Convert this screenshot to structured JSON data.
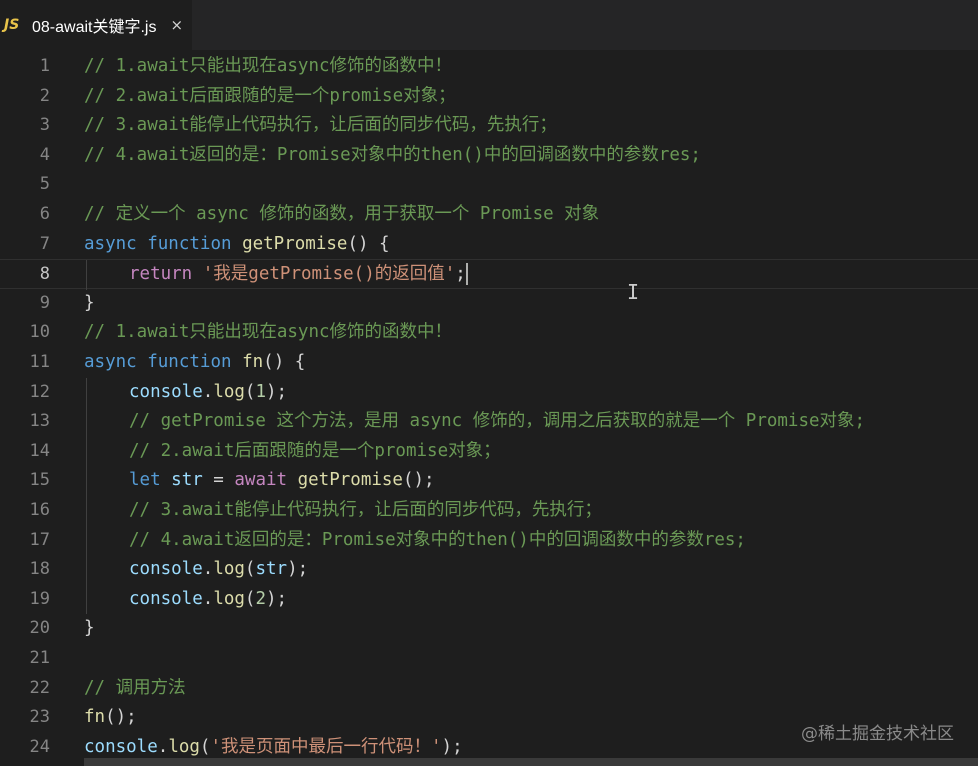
{
  "tab": {
    "icon_text": "JS",
    "filename": "08-await关键字.js",
    "close_glyph": "×"
  },
  "watermark": "@稀土掘金技术社区",
  "active_line": 8,
  "lines": [
    {
      "n": "1",
      "indent": 0,
      "tokens": [
        [
          "cm",
          "// 1.await只能出现在async修饰的函数中！"
        ]
      ]
    },
    {
      "n": "2",
      "indent": 0,
      "tokens": [
        [
          "cm",
          "// 2.await后面跟随的是一个promise对象；"
        ]
      ]
    },
    {
      "n": "3",
      "indent": 0,
      "tokens": [
        [
          "cm",
          "// 3.await能停止代码执行，让后面的同步代码，先执行；"
        ]
      ]
    },
    {
      "n": "4",
      "indent": 0,
      "tokens": [
        [
          "cm",
          "// 4.await返回的是：Promise对象中的then()中的回调函数中的参数res;"
        ]
      ]
    },
    {
      "n": "5",
      "indent": 0,
      "tokens": []
    },
    {
      "n": "6",
      "indent": 0,
      "tokens": [
        [
          "cm",
          "// 定义一个 async 修饰的函数，用于获取一个 Promise 对象"
        ]
      ]
    },
    {
      "n": "7",
      "indent": 0,
      "tokens": [
        [
          "kw",
          "async"
        ],
        [
          "pun",
          " "
        ],
        [
          "kw",
          "function"
        ],
        [
          "pun",
          " "
        ],
        [
          "fn",
          "getPromise"
        ],
        [
          "pun",
          "() {"
        ]
      ]
    },
    {
      "n": "8",
      "indent": 1,
      "tokens": [
        [
          "ctl",
          "return"
        ],
        [
          "pun",
          " "
        ],
        [
          "str",
          "'我是getPromise()的返回值'"
        ],
        [
          "pun",
          ";"
        ]
      ],
      "cursor": true
    },
    {
      "n": "9",
      "indent": 0,
      "tokens": [
        [
          "pun",
          "}"
        ]
      ]
    },
    {
      "n": "10",
      "indent": 0,
      "tokens": [
        [
          "cm",
          "// 1.await只能出现在async修饰的函数中！"
        ]
      ]
    },
    {
      "n": "11",
      "indent": 0,
      "tokens": [
        [
          "kw",
          "async"
        ],
        [
          "pun",
          " "
        ],
        [
          "kw",
          "function"
        ],
        [
          "pun",
          " "
        ],
        [
          "fn",
          "fn"
        ],
        [
          "pun",
          "() {"
        ]
      ]
    },
    {
      "n": "12",
      "indent": 1,
      "tokens": [
        [
          "var",
          "console"
        ],
        [
          "pun",
          "."
        ],
        [
          "fn",
          "log"
        ],
        [
          "pun",
          "("
        ],
        [
          "num",
          "1"
        ],
        [
          "pun",
          ");"
        ]
      ]
    },
    {
      "n": "13",
      "indent": 1,
      "tokens": [
        [
          "cm",
          "// getPromise 这个方法，是用 async 修饰的，调用之后获取的就是一个 Promise对象;"
        ]
      ]
    },
    {
      "n": "14",
      "indent": 1,
      "tokens": [
        [
          "cm",
          "// 2.await后面跟随的是一个promise对象；"
        ]
      ]
    },
    {
      "n": "15",
      "indent": 1,
      "tokens": [
        [
          "kw",
          "let"
        ],
        [
          "pun",
          " "
        ],
        [
          "var",
          "str"
        ],
        [
          "pun",
          " = "
        ],
        [
          "ctl",
          "await"
        ],
        [
          "pun",
          " "
        ],
        [
          "fn",
          "getPromise"
        ],
        [
          "pun",
          "();"
        ]
      ]
    },
    {
      "n": "16",
      "indent": 1,
      "tokens": [
        [
          "cm",
          "// 3.await能停止代码执行，让后面的同步代码，先执行；"
        ]
      ]
    },
    {
      "n": "17",
      "indent": 1,
      "tokens": [
        [
          "cm",
          "// 4.await返回的是：Promise对象中的then()中的回调函数中的参数res;"
        ]
      ]
    },
    {
      "n": "18",
      "indent": 1,
      "tokens": [
        [
          "var",
          "console"
        ],
        [
          "pun",
          "."
        ],
        [
          "fn",
          "log"
        ],
        [
          "pun",
          "("
        ],
        [
          "var",
          "str"
        ],
        [
          "pun",
          ");"
        ]
      ]
    },
    {
      "n": "19",
      "indent": 1,
      "tokens": [
        [
          "var",
          "console"
        ],
        [
          "pun",
          "."
        ],
        [
          "fn",
          "log"
        ],
        [
          "pun",
          "("
        ],
        [
          "num",
          "2"
        ],
        [
          "pun",
          ");"
        ]
      ]
    },
    {
      "n": "20",
      "indent": 0,
      "tokens": [
        [
          "pun",
          "}"
        ]
      ]
    },
    {
      "n": "21",
      "indent": 0,
      "tokens": []
    },
    {
      "n": "22",
      "indent": 0,
      "tokens": [
        [
          "cm",
          "// 调用方法"
        ]
      ]
    },
    {
      "n": "23",
      "indent": 0,
      "tokens": [
        [
          "fn",
          "fn"
        ],
        [
          "pun",
          "();"
        ]
      ]
    },
    {
      "n": "24",
      "indent": 0,
      "tokens": [
        [
          "var",
          "console"
        ],
        [
          "pun",
          "."
        ],
        [
          "fn",
          "log"
        ],
        [
          "pun",
          "("
        ],
        [
          "str",
          "'我是页面中最后一行代码！'"
        ],
        [
          "pun",
          ");"
        ]
      ]
    }
  ]
}
